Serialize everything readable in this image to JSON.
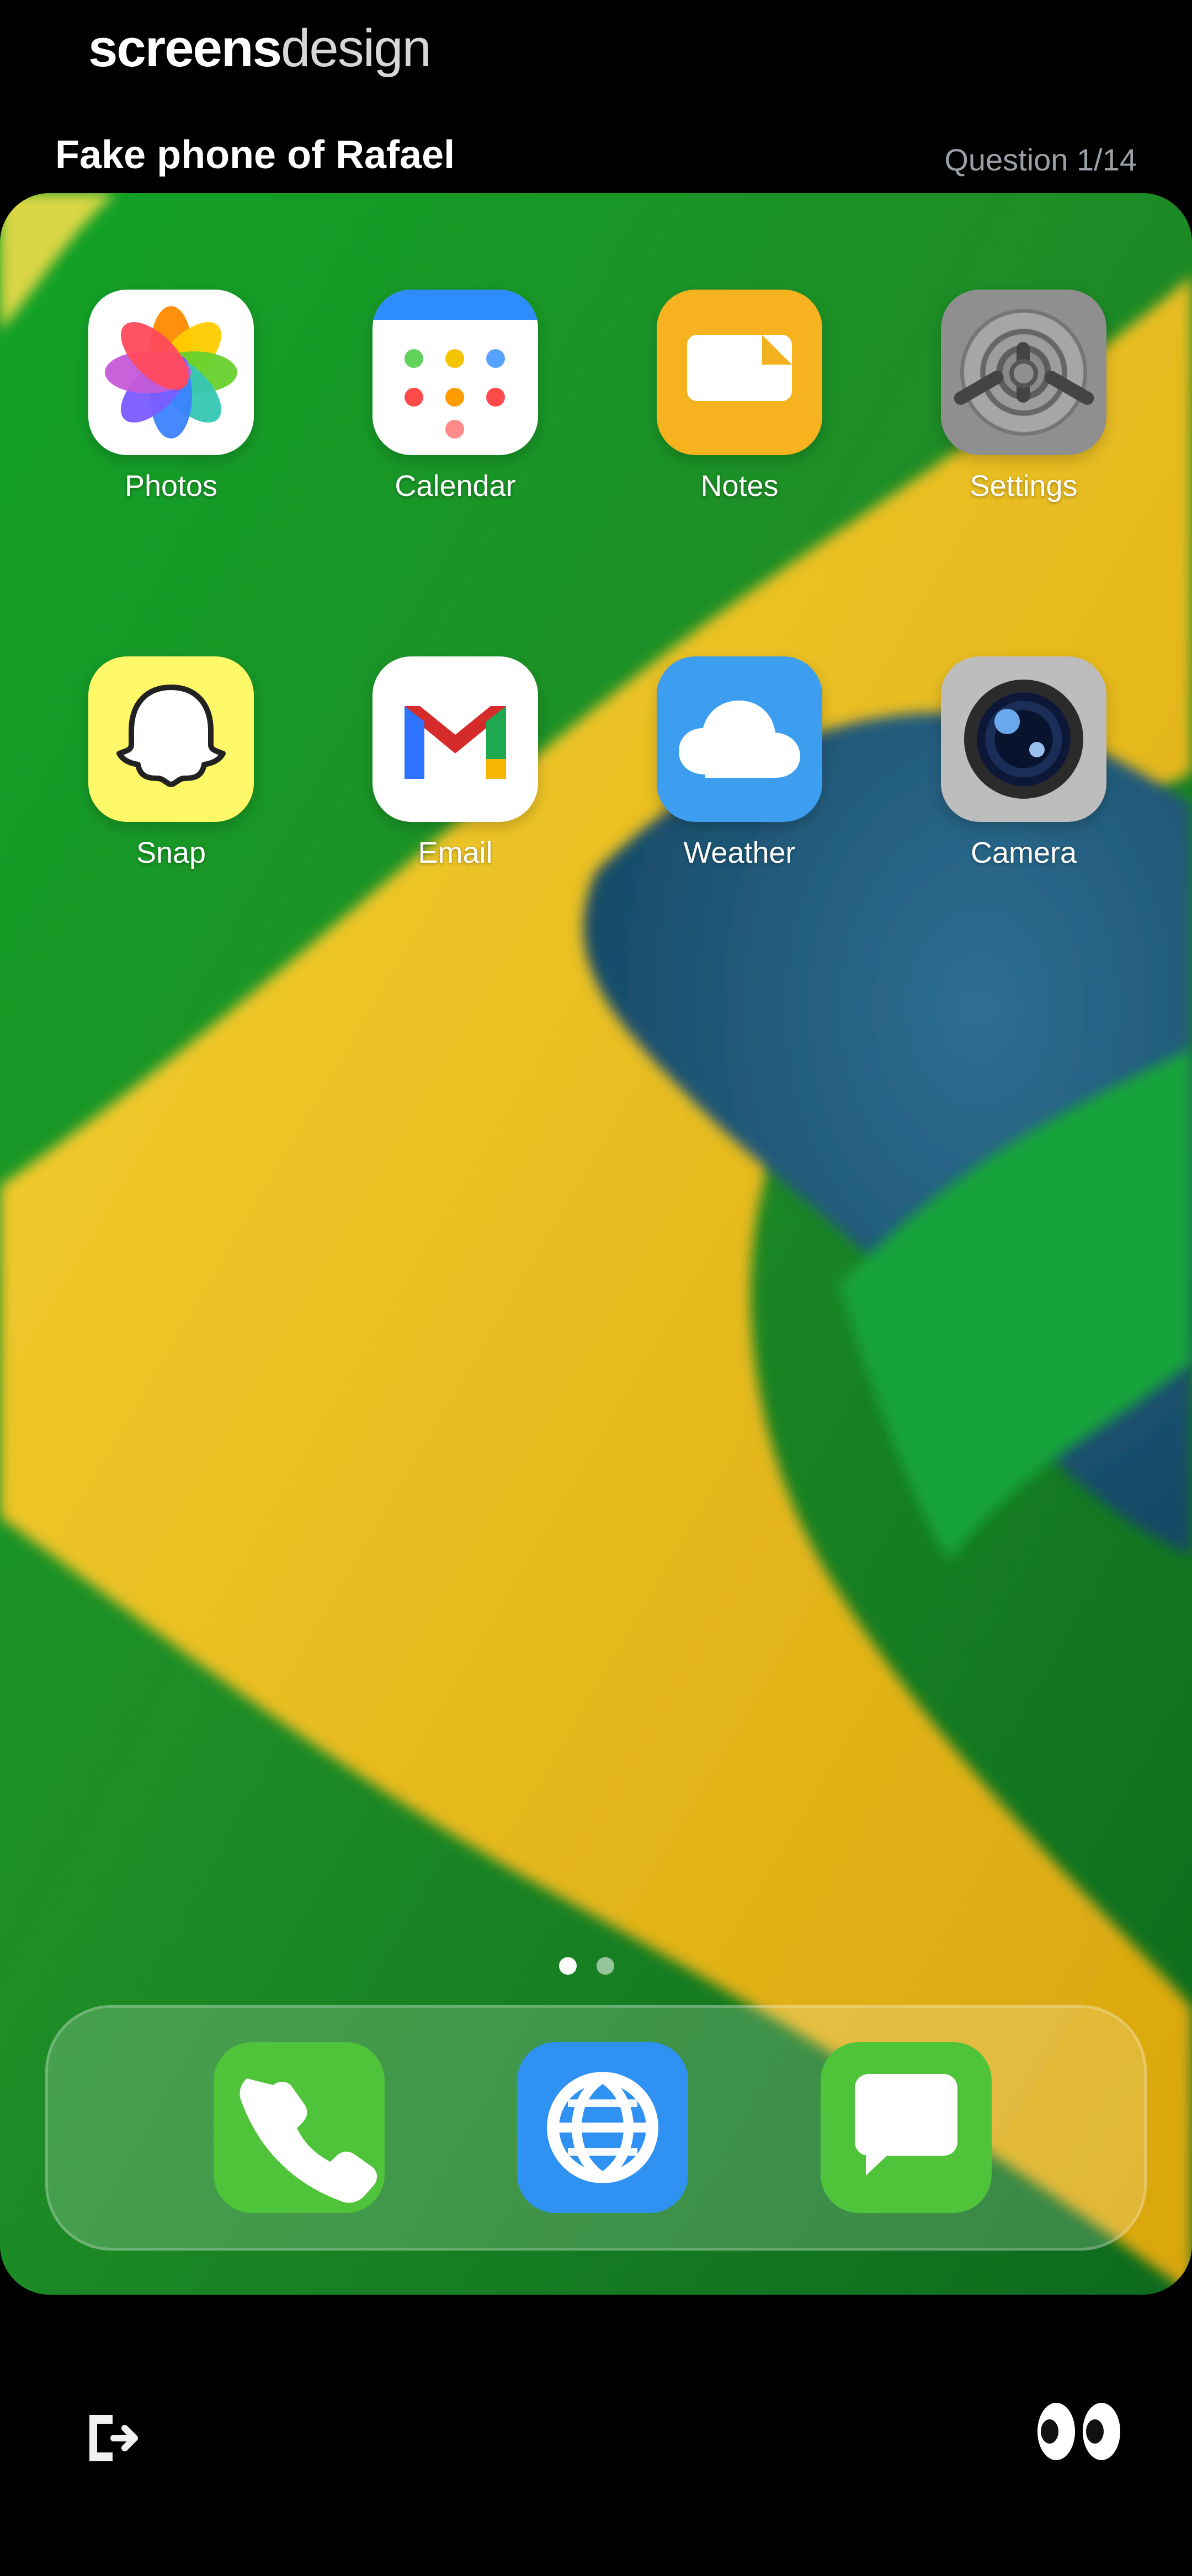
{
  "brand": {
    "part1": "screens",
    "part2": "design"
  },
  "header": {
    "title": "Fake phone of Rafael",
    "question": "Question 1/14"
  },
  "apps": [
    {
      "label": "Photos",
      "icon": "photos-icon"
    },
    {
      "label": "Calendar",
      "icon": "calendar-icon"
    },
    {
      "label": "Notes",
      "icon": "notes-icon"
    },
    {
      "label": "Settings",
      "icon": "settings-icon"
    },
    {
      "label": "Snap",
      "icon": "snap-icon"
    },
    {
      "label": "Email",
      "icon": "email-icon"
    },
    {
      "label": "Weather",
      "icon": "weather-icon"
    },
    {
      "label": "Camera",
      "icon": "camera-icon"
    }
  ],
  "dock": [
    {
      "label": "Phone",
      "icon": "phone-icon"
    },
    {
      "label": "Browser",
      "icon": "globe-icon"
    },
    {
      "label": "Messages",
      "icon": "message-icon"
    }
  ],
  "pager": {
    "pages": 2,
    "active": 1
  },
  "colors": {
    "background": "#000000",
    "wallpaper_green": "#1d7f27",
    "wallpaper_yellow": "#f1c319",
    "wallpaper_blue": "#1f5a7d"
  },
  "bottom": {
    "logout_icon": "logout-icon",
    "eyes_icon": "eyes-icon"
  }
}
